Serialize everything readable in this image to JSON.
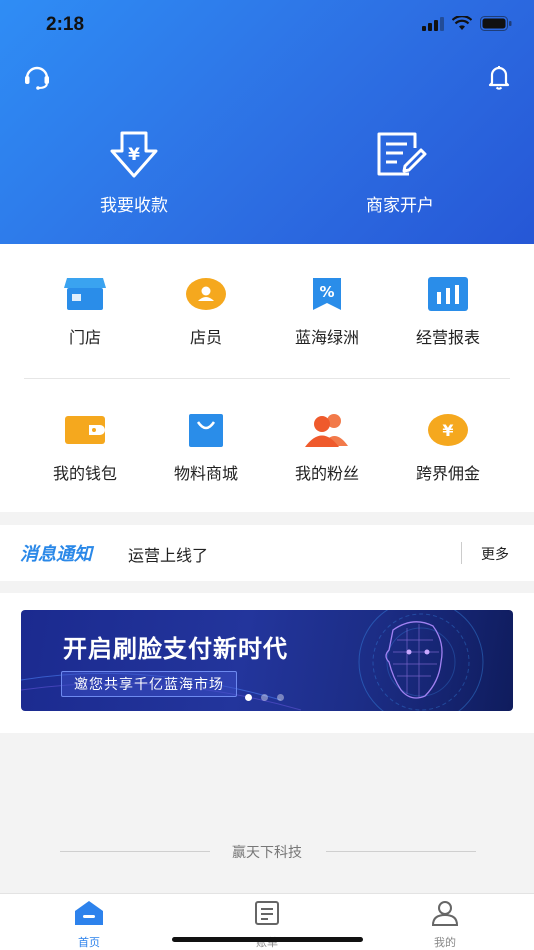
{
  "status_bar": {
    "time": "2:18"
  },
  "hero": {
    "receive_label": "我要收款",
    "merchant_label": "商家开户"
  },
  "grid": {
    "row1": [
      {
        "label": "门店",
        "icon": "store-icon",
        "color": "#2a8de9"
      },
      {
        "label": "店员",
        "icon": "staff-icon",
        "color": "#f3a21c"
      },
      {
        "label": "蓝海绿洲",
        "icon": "discount-bookmark-icon",
        "color": "#2a8de9"
      },
      {
        "label": "经营报表",
        "icon": "bar-chart-icon",
        "color": "#2a8de9"
      }
    ],
    "row2": [
      {
        "label": "我的钱包",
        "icon": "wallet-icon",
        "color": "#f3a21c"
      },
      {
        "label": "物料商城",
        "icon": "shopping-bag-icon",
        "color": "#2a8de9"
      },
      {
        "label": "我的粉丝",
        "icon": "fans-icon",
        "color": "#ef5a2c"
      },
      {
        "label": "跨界佣金",
        "icon": "yuan-coin-icon",
        "color": "#f3a21c"
      }
    ]
  },
  "notice": {
    "title": "消息通知",
    "text": "运营上线了",
    "more": "更多"
  },
  "banner": {
    "title": "开启刷脸支付新时代",
    "subtitle": "邀您共享千亿蓝海市场"
  },
  "brand": "赢天下科技",
  "tabbar": {
    "items": [
      {
        "label": "首页",
        "icon": "home-icon",
        "active": true
      },
      {
        "label": "账单",
        "icon": "bill-icon",
        "active": false
      },
      {
        "label": "我的",
        "icon": "profile-icon",
        "active": false
      }
    ]
  },
  "colors": {
    "primary": "#2d82ec",
    "header_start": "#2f8df5",
    "header_end": "#2657d6"
  }
}
